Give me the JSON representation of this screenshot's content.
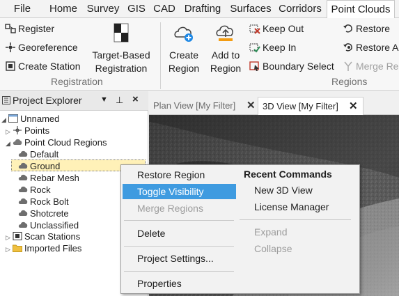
{
  "menu": {
    "items": [
      "File",
      "Home",
      "Survey",
      "GIS",
      "CAD",
      "Drafting",
      "Surfaces",
      "Corridors",
      "Point Clouds"
    ],
    "active": "Point Clouds"
  },
  "ribbon": {
    "registration": {
      "register": "Register",
      "georeference": "Georeference",
      "create_station": "Create Station",
      "target_based_line1": "Target-Based",
      "target_based_line2": "Registration",
      "group_label": "Registration"
    },
    "regions": {
      "create_region_line1": "Create",
      "create_region_line2": "Region",
      "add_to_region_line1": "Add to",
      "add_to_region_line2": "Region",
      "keep_out": "Keep Out",
      "keep_in": "Keep In",
      "boundary_select": "Boundary Select",
      "restore": "Restore",
      "restore_a": "Restore A",
      "merge_re": "Merge Re",
      "group_label": "Regions"
    }
  },
  "project_explorer": {
    "title": "Project Explorer",
    "tree": [
      {
        "label": "Unnamed",
        "icon": "project-icon"
      },
      {
        "label": "Points",
        "icon": "points-icon"
      },
      {
        "label": "Point Cloud Regions",
        "icon": "cloud-regions-icon"
      },
      {
        "label": "Default",
        "icon": "region-icon"
      },
      {
        "label": "Ground",
        "icon": "region-icon",
        "selected": true
      },
      {
        "label": "Rebar Mesh",
        "icon": "region-icon"
      },
      {
        "label": "Rock",
        "icon": "region-icon"
      },
      {
        "label": "Rock Bolt",
        "icon": "region-icon"
      },
      {
        "label": "Shotcrete",
        "icon": "region-icon"
      },
      {
        "label": "Unclassified",
        "icon": "region-icon"
      },
      {
        "label": "Scan Stations",
        "icon": "scan-station-icon"
      },
      {
        "label": "Imported Files",
        "icon": "folder-icon"
      }
    ]
  },
  "doc_tabs": [
    {
      "label": "Plan View [My Filter]",
      "active": false
    },
    {
      "label": "3D View [My Filter]",
      "active": true
    }
  ],
  "context_menu": {
    "restore_region": "Restore Region",
    "toggle_visibility": "Toggle Visibility",
    "merge_regions": "Merge Regions",
    "delete": "Delete",
    "project_settings": "Project Settings...",
    "properties": "Properties",
    "recent_header": "Recent Commands",
    "new_3d_view": "New 3D View",
    "license_manager": "License Manager",
    "expand": "Expand",
    "collapse": "Collapse"
  },
  "colors": {
    "accent": "#3f9be0",
    "selection": "#fff1b8",
    "keep_red": "#c0392b",
    "keep_green": "#2e8b57",
    "folder": "#f0c040"
  }
}
